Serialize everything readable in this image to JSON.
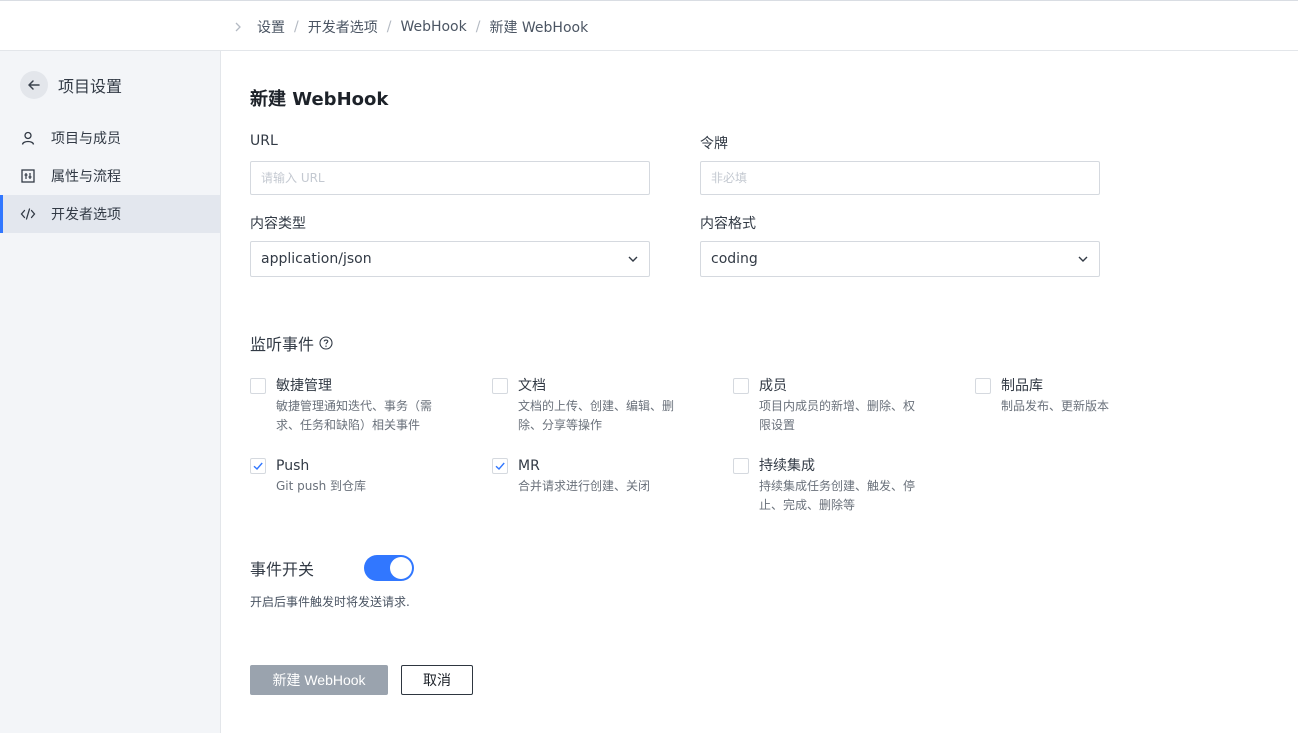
{
  "breadcrumb": [
    "设置",
    "开发者选项",
    "WebHook",
    "新建 WebHook"
  ],
  "sidebar": {
    "title": "项目设置",
    "items": [
      {
        "label": "项目与成员",
        "icon": "user-icon",
        "active": false
      },
      {
        "label": "属性与流程",
        "icon": "flow-icon",
        "active": false
      },
      {
        "label": "开发者选项",
        "icon": "code-icon",
        "active": true
      }
    ]
  },
  "form": {
    "title": "新建 WebHook",
    "url": {
      "label": "URL",
      "placeholder": "请输入 URL",
      "value": ""
    },
    "token": {
      "label": "令牌",
      "placeholder": "非必填",
      "value": ""
    },
    "content_type": {
      "label": "内容类型",
      "value": "application/json"
    },
    "content_format": {
      "label": "内容格式",
      "value": "coding"
    }
  },
  "events": {
    "title": "监听事件",
    "items": [
      {
        "name": "敏捷管理",
        "desc": "敏捷管理通知迭代、事务（需求、任务和缺陷）相关事件",
        "checked": false
      },
      {
        "name": "文档",
        "desc": "文档的上传、创建、编辑、删除、分享等操作",
        "checked": false
      },
      {
        "name": "成员",
        "desc": "项目内成员的新增、删除、权限设置",
        "checked": false
      },
      {
        "name": "制品库",
        "desc": "制品发布、更新版本",
        "checked": false
      },
      {
        "name": "Push",
        "desc": "Git push 到仓库",
        "checked": true
      },
      {
        "name": "MR",
        "desc": "合并请求进行创建、关闭",
        "checked": true
      },
      {
        "name": "持续集成",
        "desc": "持续集成任务创建、触发、停止、完成、删除等",
        "checked": false
      }
    ]
  },
  "switch": {
    "label": "事件开关",
    "desc": "开启后事件触发时将发送请求.",
    "on": true
  },
  "actions": {
    "submit": "新建 WebHook",
    "cancel": "取消"
  },
  "colors": {
    "accent": "#3177ff",
    "disabled_button": "#9aa3ae",
    "sidebar_bg": "#f3f5f8"
  }
}
